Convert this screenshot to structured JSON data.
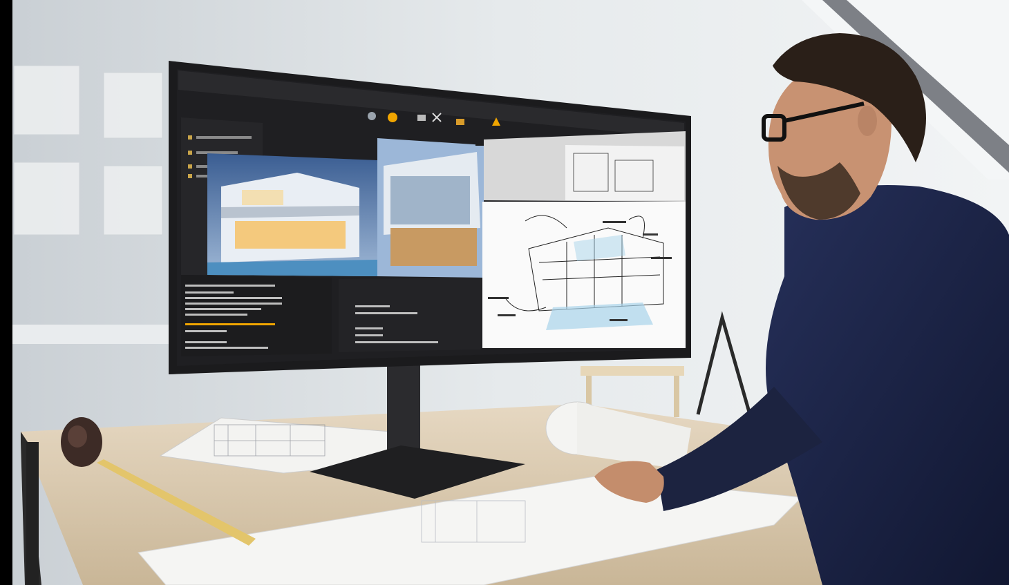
{
  "scene": {
    "subject": "architect",
    "palette": {
      "wall": "#d9dee2",
      "window": "#eef2f4",
      "desk": "#d8c9b2",
      "desk_edge": "#2a2a2a",
      "monitor_bezel": "#1b1b1d",
      "app_bg": "#1f1f22",
      "app_panel": "#2a2a2d",
      "accent_orange": "#f0a500",
      "shirt": "#1c2340",
      "skin": "#c89272",
      "hair": "#2a1f18",
      "tape_measure": "#3d2b26",
      "tape_blade": "#e3c56b"
    },
    "monitor": {
      "app": {
        "toolbar_icons": [
          "render-icon",
          "sun-icon",
          "camera-icon",
          "scissors-icon",
          "layers-icon",
          "warning-icon"
        ],
        "panels": [
          "scene-tree",
          "render-preview",
          "sketch-preview",
          "console-output",
          "properties"
        ]
      }
    }
  }
}
